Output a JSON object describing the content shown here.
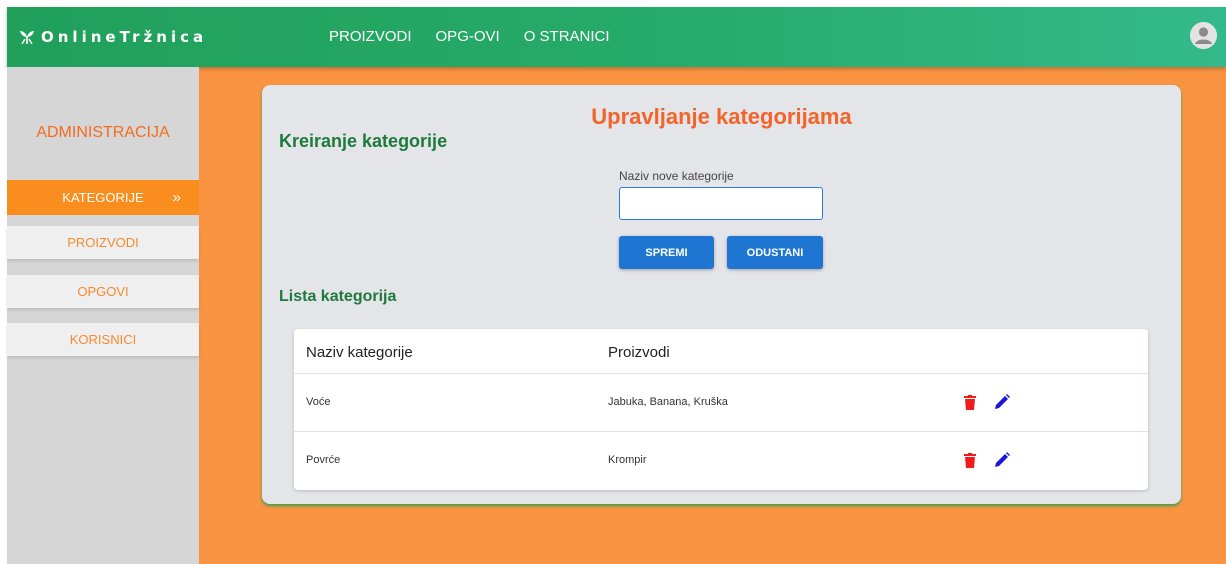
{
  "brand": {
    "name": "OnlineTržnica",
    "icon": "sprout-icon"
  },
  "nav": [
    {
      "label": "PROIZVODI"
    },
    {
      "label": "OPG-OVI"
    },
    {
      "label": "O STRANICI"
    }
  ],
  "user": {
    "icon": "user-avatar-icon"
  },
  "sidebar": {
    "title": "ADMINISTRACIJA",
    "items": [
      {
        "label": "KATEGORIJE",
        "active": true,
        "suffix": "»"
      },
      {
        "label": "PROIZVODI"
      },
      {
        "label": "OPGOVI"
      },
      {
        "label": "KORISNICI"
      }
    ]
  },
  "main": {
    "title": "Upravljanje kategorijama",
    "create": {
      "title": "Kreiranje kategorije",
      "field_label": "Naziv nove kategorije",
      "field_value": "",
      "save_label": "SPREMI",
      "cancel_label": "ODUSTANI"
    },
    "list": {
      "title": "Lista kategorija",
      "columns": [
        "Naziv kategorije",
        "Proizvodi"
      ],
      "rows": [
        {
          "name": "Voće",
          "products": "Jabuka, Banana, Kruška"
        },
        {
          "name": "Povrće",
          "products": "Krompir"
        }
      ]
    }
  },
  "colors": {
    "topbar": "#20a05a",
    "background": "#fa9442",
    "accent": "#f56b1e",
    "heading_green": "#1e7a3c",
    "button_blue": "#1e76d2",
    "delete_red": "#f01c1c",
    "edit_blue": "#1a16d9"
  }
}
